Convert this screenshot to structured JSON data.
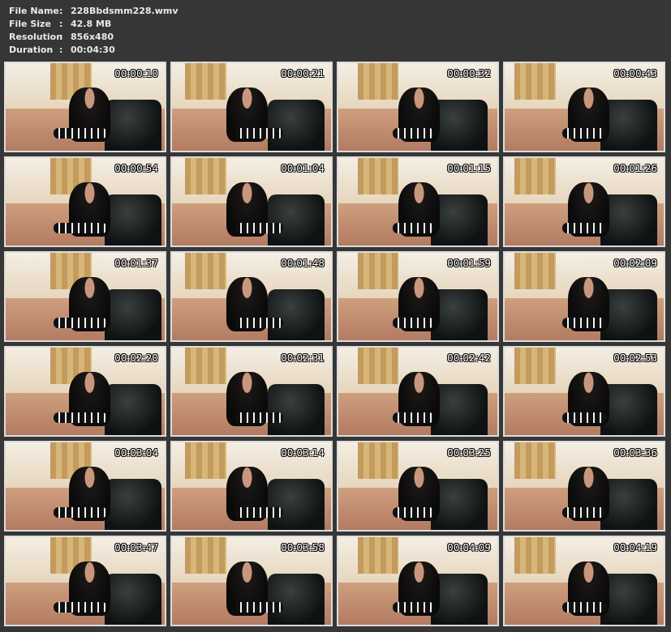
{
  "info": {
    "rows": [
      {
        "key": "File Name",
        "value": "228Bbdsmm228.wmv"
      },
      {
        "key": "File Size",
        "value": "42.8 MB"
      },
      {
        "key": "Resolution",
        "value": "856x480"
      },
      {
        "key": "Duration",
        "value": "00:04:30"
      }
    ]
  },
  "thumbnails": [
    {
      "time": "00:00:10"
    },
    {
      "time": "00:00:21"
    },
    {
      "time": "00:00:32"
    },
    {
      "time": "00:00:43"
    },
    {
      "time": "00:00:54"
    },
    {
      "time": "00:01:04"
    },
    {
      "time": "00:01:15"
    },
    {
      "time": "00:01:26"
    },
    {
      "time": "00:01:37"
    },
    {
      "time": "00:01:48"
    },
    {
      "time": "00:01:59"
    },
    {
      "time": "00:02:09"
    },
    {
      "time": "00:02:20"
    },
    {
      "time": "00:02:31"
    },
    {
      "time": "00:02:42"
    },
    {
      "time": "00:02:53"
    },
    {
      "time": "00:03:04"
    },
    {
      "time": "00:03:14"
    },
    {
      "time": "00:03:25"
    },
    {
      "time": "00:03:36"
    },
    {
      "time": "00:03:47"
    },
    {
      "time": "00:03:58"
    },
    {
      "time": "00:04:09"
    },
    {
      "time": "00:04:19"
    }
  ]
}
